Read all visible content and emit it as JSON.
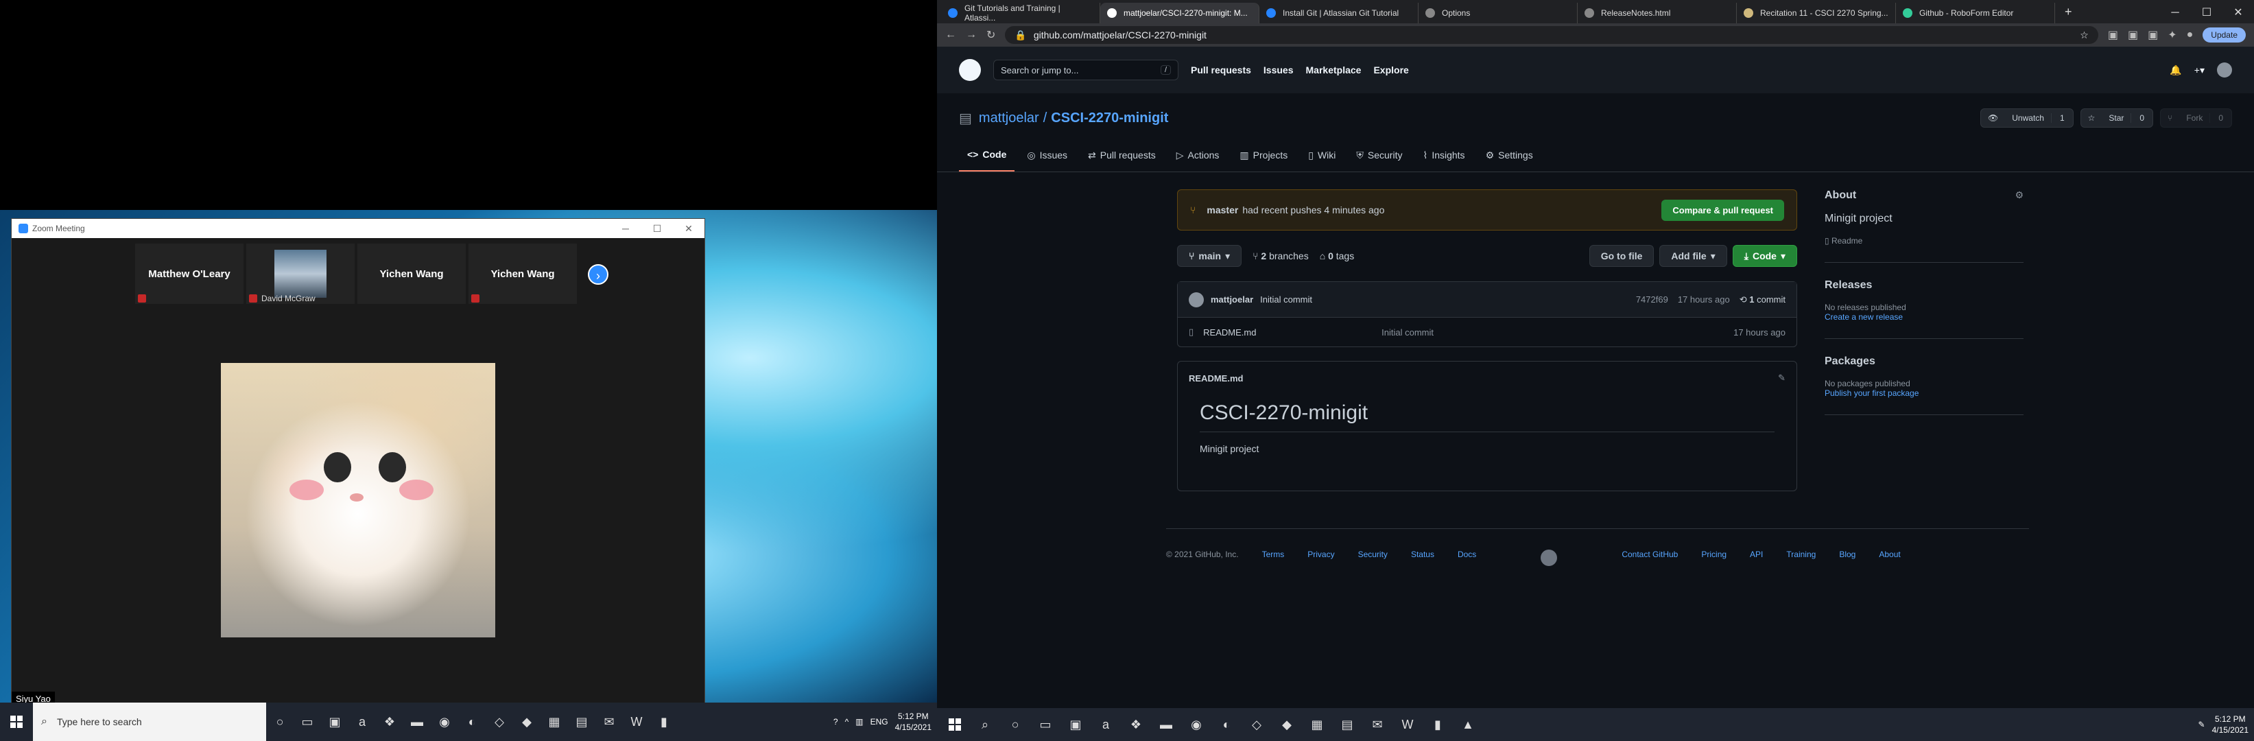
{
  "zoom": {
    "title": "Zoom Meeting",
    "participants": [
      {
        "name": "Matthew O'Leary",
        "type": "name"
      },
      {
        "name": "David McGraw",
        "type": "video"
      },
      {
        "name": "Yichen Wang",
        "type": "name"
      },
      {
        "name": "Yichen Wang",
        "type": "name"
      }
    ],
    "speaker": "Siyu Yao"
  },
  "left_taskbar": {
    "search_placeholder": "Type here to search",
    "lang": "ENG",
    "time": "5:12 PM",
    "date": "4/15/2021"
  },
  "chrome": {
    "tabs": [
      {
        "label": "Git Tutorials and Training | Atlassi...",
        "active": false
      },
      {
        "label": "mattjoelar/CSCI-2270-minigit: M...",
        "active": true
      },
      {
        "label": "Install Git | Atlassian Git Tutorial",
        "active": false
      },
      {
        "label": "Options",
        "active": false
      },
      {
        "label": "ReleaseNotes.html",
        "active": false
      },
      {
        "label": "Recitation 11 - CSCI 2270 Spring...",
        "active": false
      },
      {
        "label": "Github - RoboForm Editor",
        "active": false
      }
    ],
    "url": "github.com/mattjoelar/CSCI-2270-minigit",
    "update_label": "Update"
  },
  "github": {
    "search_placeholder": "Search or jump to...",
    "nav": [
      "Pull requests",
      "Issues",
      "Marketplace",
      "Explore"
    ],
    "owner": "mattjoelar",
    "repo": "CSCI-2270-minigit",
    "unwatch_label": "Unwatch",
    "unwatch_count": "1",
    "star_label": "Star",
    "star_count": "0",
    "fork_label": "Fork",
    "fork_count": "0",
    "tabs": [
      "Code",
      "Issues",
      "Pull requests",
      "Actions",
      "Projects",
      "Wiki",
      "Security",
      "Insights",
      "Settings"
    ],
    "banner_branch": "master",
    "banner_text": "had recent pushes 4 minutes ago",
    "compare_label": "Compare & pull request",
    "branch": "main",
    "branches_count": "2",
    "branches_label": "branches",
    "tags_count": "0",
    "tags_label": "tags",
    "go_to_file": "Go to file",
    "add_file": "Add file",
    "code_btn": "Code",
    "commit_author": "mattjoelar",
    "commit_msg": "Initial commit",
    "commit_sha": "7472f69",
    "commit_time": "17 hours ago",
    "commit_count": "1",
    "commit_label": "commit",
    "file_name": "README.md",
    "file_msg": "Initial commit",
    "file_time": "17 hours ago",
    "readme_title": "README.md",
    "readme_h1": "CSCI-2270-minigit",
    "readme_p": "Minigit project",
    "about": "About",
    "about_desc": "Minigit project",
    "readme_link": "Readme",
    "releases": "Releases",
    "releases_none": "No releases published",
    "releases_link": "Create a new release",
    "packages": "Packages",
    "packages_none": "No packages published",
    "packages_link": "Publish your first package",
    "footer_copy": "© 2021 GitHub, Inc.",
    "footer_links": [
      "Terms",
      "Privacy",
      "Security",
      "Status",
      "Docs"
    ],
    "footer_links2": [
      "Contact GitHub",
      "Pricing",
      "API",
      "Training",
      "Blog",
      "About"
    ]
  },
  "right_taskbar": {
    "time": "5:12 PM",
    "date": "4/15/2021"
  }
}
